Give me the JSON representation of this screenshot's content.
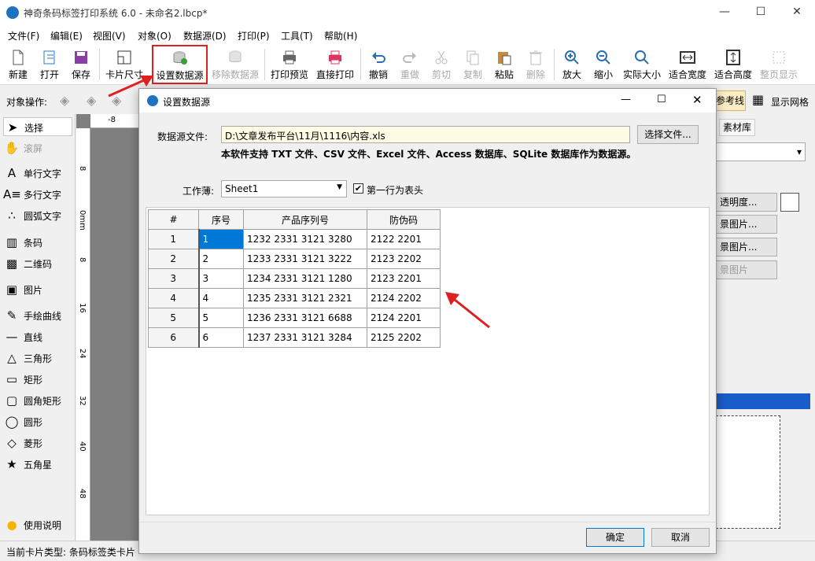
{
  "window": {
    "title": "神奇条码标签打印系统 6.0 - 未命名2.lbcp*",
    "minimize": "—",
    "maximize": "☐",
    "close": "✕"
  },
  "menu": [
    "文件(F)",
    "编辑(E)",
    "视图(V)",
    "对象(O)",
    "数据源(D)",
    "打印(P)",
    "工具(T)",
    "帮助(H)"
  ],
  "toolbar": {
    "new": "新建",
    "open": "打开",
    "save": "保存",
    "card_size": "卡片尺寸",
    "set_datasource": "设置数据源",
    "remove_datasource": "移除数据源",
    "print_preview": "打印预览",
    "direct_print": "直接打印",
    "undo": "撤销",
    "redo": "重做",
    "cut": "剪切",
    "copy": "复制",
    "paste": "粘贴",
    "delete": "删除",
    "zoom_in": "放大",
    "zoom_out": "缩小",
    "actual_size": "实际大小",
    "fit_width": "适合宽度",
    "fit_height": "适合高度",
    "full_page": "整页显示"
  },
  "objbar": {
    "label": "对象操作:",
    "guides": "参考线",
    "show_grid": "显示网格"
  },
  "tools": [
    "选择",
    "滚屏",
    "单行文字",
    "多行文字",
    "圆弧文字",
    "条码",
    "二维码",
    "图片",
    "手绘曲线",
    "直线",
    "三角形",
    "矩形",
    "圆角矩形",
    "圆形",
    "菱形",
    "五角星",
    "使用说明"
  ],
  "ruler": {
    "h": [
      "-8"
    ],
    "v": [
      "8",
      "0mm",
      "8",
      "16",
      "24",
      "32",
      "40",
      "48"
    ]
  },
  "right_panel": {
    "tab": "素材库",
    "transparency": "透明度...",
    "bg1": "景图片...",
    "bg2": "景图片...",
    "bg3": "景图片"
  },
  "status": {
    "text": "当前卡片类型: 条码标签类卡片"
  },
  "dialog": {
    "title": "设置数据源",
    "file_label": "数据源文件:",
    "file_path": "D:\\文章发布平台\\11月\\1116\\内容.xls",
    "choose_file": "选择文件...",
    "note": "本软件支持 TXT 文件、CSV 文件、Excel 文件、Access 数据库、SQLite 数据库作为数据源。",
    "sheet_label": "工作薄:",
    "sheet_value": "Sheet1",
    "first_row_header": "第一行为表头",
    "ok": "确定",
    "cancel": "取消",
    "table": {
      "headers": [
        "#",
        "序号",
        "产品序列号",
        "防伪码"
      ],
      "rows": [
        [
          "1",
          "1",
          "1232 2331 3121 3280",
          "2122 2201"
        ],
        [
          "2",
          "2",
          "1233 2331 3121 3222",
          "2123 2202"
        ],
        [
          "3",
          "3",
          "1234 2331 3121 1280",
          "2123 2201"
        ],
        [
          "4",
          "4",
          "1235 2331 3121 2321",
          "2124 2202"
        ],
        [
          "5",
          "5",
          "1236 2331 3121 6688",
          "2124 2201"
        ],
        [
          "6",
          "6",
          "1237 2331 3121 3284",
          "2125 2202"
        ]
      ]
    }
  },
  "colors": {
    "accent": "#0078d7",
    "highlight": "#e02020"
  }
}
